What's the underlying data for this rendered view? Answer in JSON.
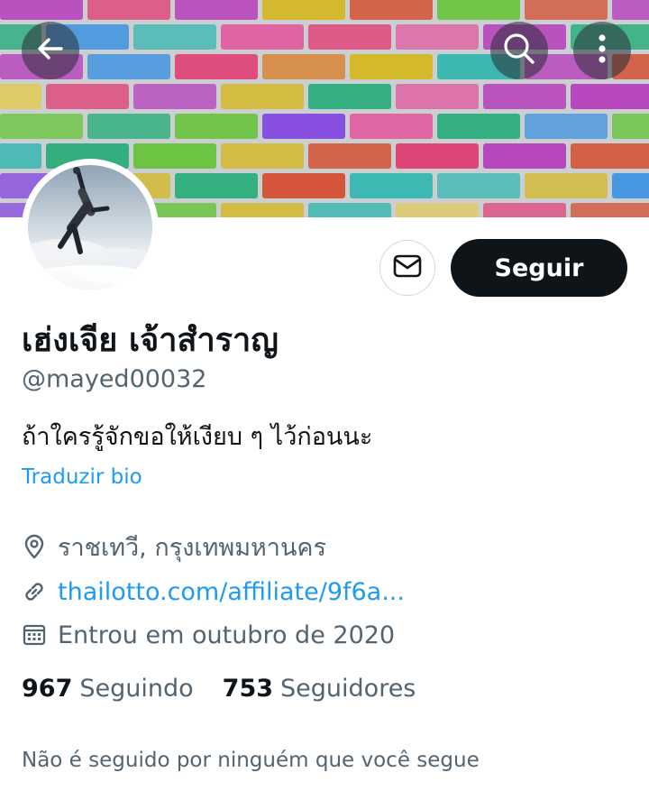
{
  "colors": {
    "accent": "#1d9bf0",
    "text_primary": "#0f1419",
    "text_secondary": "#536471",
    "follow_button_bg": "#0f1419"
  },
  "header": {
    "back_icon": "arrow-left-icon",
    "search_icon": "search-icon",
    "more_icon": "more-vertical-icon",
    "banner_image": "colorful-graffiti-brick-wall"
  },
  "profile": {
    "avatar_image": "skydiver-over-clouds",
    "message_icon": "mail-icon",
    "follow_label": "Seguir",
    "display_name": "เฮ่งเจีย เจ้าสำราญ",
    "handle": "@mayed00032",
    "bio": "ถ้าใครรู้จักขอให้เงียบ ๆ ไว้ก่อนนะ",
    "translate_bio": "Traduzir bio",
    "location": "ราชเทวี, กรุงเทพมหานคร",
    "website": "thailotto.com/affiliate/9f6a...",
    "joined": "Entrou em outubro de 2020",
    "following_count": "967",
    "following_label": "Seguindo",
    "followers_count": "753",
    "followers_label": "Seguidores",
    "not_followed_note": "Não é seguido por ninguém que você segue"
  }
}
